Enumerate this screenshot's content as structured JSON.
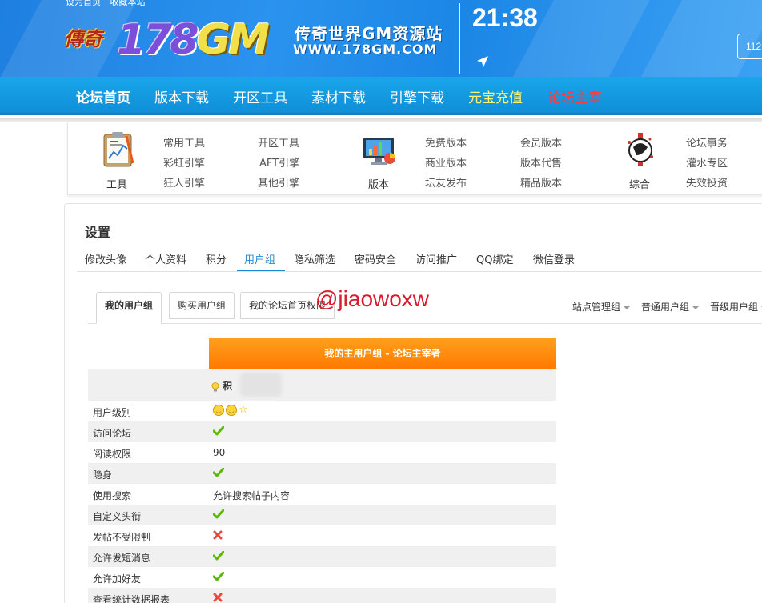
{
  "banner": {
    "toplinks": [
      "设为首页",
      "收藏本站"
    ],
    "logo_seal": "傳奇",
    "logo_main_a": "178",
    "logo_main_b": "GM",
    "logo_sub1": "传奇世界GM资源站",
    "logo_sub2": "WWW.178GM.COM",
    "clock": "21:38",
    "search_value": "112"
  },
  "navbar": {
    "items": [
      "论坛首页",
      "版本下载",
      "开区工具",
      "素材下载",
      "引擎下载",
      "元宝充值",
      "论坛主宰"
    ],
    "colors": {
      "active": "#ffffff",
      "yellow": "#fff36e",
      "red": "#ff3b3b"
    }
  },
  "categories": {
    "tools": {
      "label": "工具",
      "links": [
        "常用工具",
        "彩虹引擎",
        "狂人引擎",
        "开区工具",
        "AFT引擎",
        "其他引擎"
      ]
    },
    "versions": {
      "label": "版本",
      "links": [
        "免费版本",
        "商业版本",
        "坛友发布",
        "会员版本",
        "版本代售",
        "精品版本"
      ]
    },
    "general": {
      "label": "综合",
      "links": [
        "论坛事务",
        "灌水专区",
        "失效投资"
      ]
    }
  },
  "settings": {
    "title": "设置",
    "tabs": [
      "修改头像",
      "个人资料",
      "积分",
      "用户组",
      "隐私筛选",
      "密码安全",
      "访问推广",
      "QQ绑定",
      "微信登录"
    ],
    "active_tab": "用户组",
    "subtabs": [
      "我的用户组",
      "购买用户组",
      "我的论坛首页权限"
    ],
    "dropdowns": [
      "站点管理组",
      "普通用户组",
      "晋级用户组"
    ],
    "watermark": "@jiaowoxw"
  },
  "usergroup": {
    "header": "我的主用户组 - 论坛主宰者",
    "credit_label": "积",
    "rows": [
      {
        "key": "用户级别",
        "type": "level"
      },
      {
        "key": "访问论坛",
        "type": "check"
      },
      {
        "key": "阅读权限",
        "type": "text",
        "value": "90"
      },
      {
        "key": "隐身",
        "type": "check"
      },
      {
        "key": "使用搜索",
        "type": "text",
        "value": "允许搜索帖子内容"
      },
      {
        "key": "自定义头衔",
        "type": "check"
      },
      {
        "key": "发帖不受限制",
        "type": "cross"
      },
      {
        "key": "允许发短消息",
        "type": "check"
      },
      {
        "key": "允许加好友",
        "type": "check"
      },
      {
        "key": "查看统计数据报表",
        "type": "cross"
      }
    ],
    "colors": {
      "check": "#5cb800",
      "cross": "#e8473b",
      "header": "#ff8a00"
    }
  }
}
